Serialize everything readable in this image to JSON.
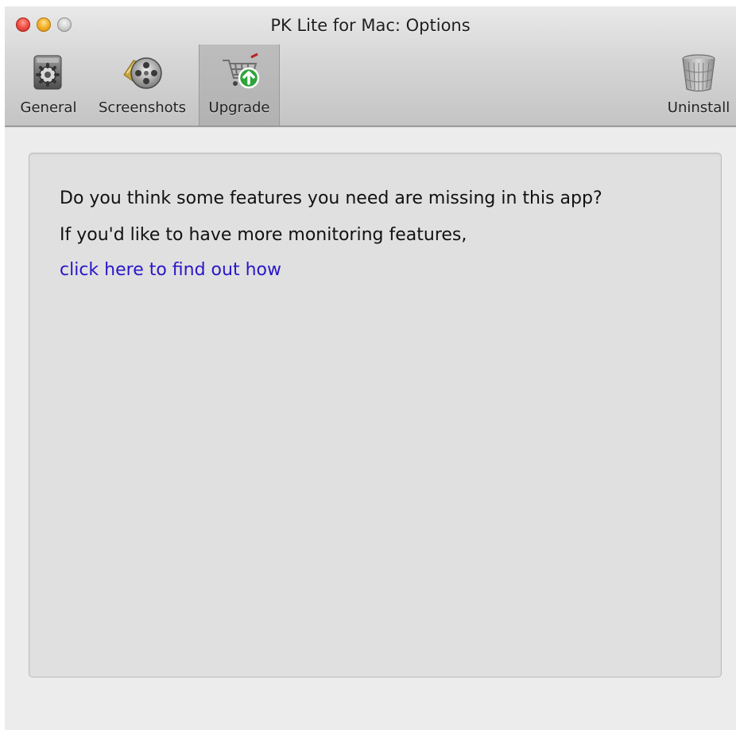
{
  "window": {
    "title": "PK Lite for Mac: Options"
  },
  "toolbar": {
    "items": [
      {
        "label": "General",
        "icon": "gear-icon"
      },
      {
        "label": "Screenshots",
        "icon": "film-reel-icon"
      },
      {
        "label": "Upgrade",
        "icon": "shopping-cart-upgrade-icon",
        "selected": true
      },
      {
        "label": "Uninstall",
        "icon": "trash-can-icon"
      }
    ]
  },
  "content": {
    "line1": "Do you think some features you need are missing in this app?",
    "line2": "If you'd like to have more monitoring features,",
    "link_text": "click here to find out how"
  },
  "colors": {
    "link": "#2a16c9",
    "close": "#f2544a",
    "minimize": "#f6b32d"
  }
}
